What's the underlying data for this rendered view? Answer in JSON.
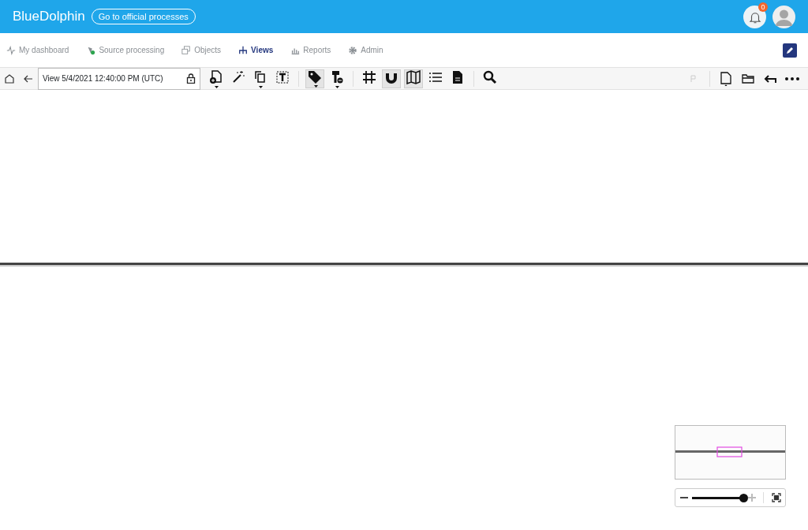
{
  "header": {
    "brand": "BlueDolphin",
    "official_button": "Go to official processes",
    "notification_count": "0"
  },
  "nav": [
    {
      "label": "My dashboard",
      "selected": false
    },
    {
      "label": "Source processing",
      "selected": false
    },
    {
      "label": "Objects",
      "selected": false
    },
    {
      "label": "Views",
      "selected": true
    },
    {
      "label": "Reports",
      "selected": false
    },
    {
      "label": "Admin",
      "selected": false
    }
  ],
  "toolbar": {
    "view_name": "View 5/4/2021 12:40:00 PM (UTC)",
    "tools": [
      {
        "kind": "add-object",
        "active": false,
        "dropdown": true
      },
      {
        "kind": "wand",
        "active": false,
        "dropdown": false
      },
      {
        "kind": "copy",
        "active": false,
        "dropdown": true
      },
      {
        "kind": "text",
        "active": false,
        "dropdown": false
      },
      {
        "kind": "sep"
      },
      {
        "kind": "tag",
        "active": true,
        "dropdown": true
      },
      {
        "kind": "paint",
        "active": false,
        "dropdown": true
      },
      {
        "kind": "sep"
      },
      {
        "kind": "grid",
        "active": false,
        "dropdown": false
      },
      {
        "kind": "magnet",
        "active": true,
        "dropdown": false
      },
      {
        "kind": "map",
        "active": true,
        "dropdown": false
      },
      {
        "kind": "list",
        "active": false,
        "dropdown": false
      },
      {
        "kind": "document",
        "active": false,
        "dropdown": false
      },
      {
        "kind": "sep"
      },
      {
        "kind": "search",
        "active": false,
        "dropdown": false
      }
    ]
  },
  "zoom": {
    "level": 1.0
  }
}
